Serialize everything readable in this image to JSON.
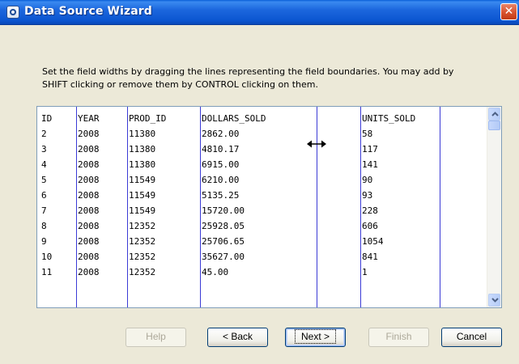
{
  "window": {
    "title": "Data Source Wizard",
    "close_glyph": "✕"
  },
  "instructions": {
    "line1": "Set the field widths by dragging the lines representing the field boundaries.  You may add by",
    "line2": "SHIFT clicking or remove them by CONTROL clicking on them."
  },
  "grid": {
    "rows": [
      [
        "ID",
        "YEAR",
        "PROD_ID",
        "DOLLARS_SOLD",
        "UNITS_SOLD"
      ],
      [
        "2",
        "2008",
        "11380",
        "2862.00",
        "58"
      ],
      [
        "3",
        "2008",
        "11380",
        "4810.17",
        "117"
      ],
      [
        "4",
        "2008",
        "11380",
        "6915.00",
        "141"
      ],
      [
        "5",
        "2008",
        "11549",
        "6210.00",
        "90"
      ],
      [
        "6",
        "2008",
        "11549",
        "5135.25",
        "93"
      ],
      [
        "7",
        "2008",
        "11549",
        "15720.00",
        "228"
      ],
      [
        "8",
        "2008",
        "12352",
        "25928.05",
        "606"
      ],
      [
        "9",
        "2008",
        "12352",
        "25706.65",
        "1054"
      ],
      [
        "10",
        "2008",
        "12352",
        "35627.00",
        "841"
      ],
      [
        "11",
        "2008",
        "12352",
        "45.00",
        "1"
      ]
    ],
    "boundary_color": "#3b3bd6"
  },
  "buttons": {
    "help": "Help",
    "back": "< Back",
    "next": "Next >",
    "finish": "Finish",
    "cancel": "Cancel"
  },
  "icons": {
    "app": "data-source-icon",
    "cursor": "horizontal-resize-cursor-icon"
  }
}
